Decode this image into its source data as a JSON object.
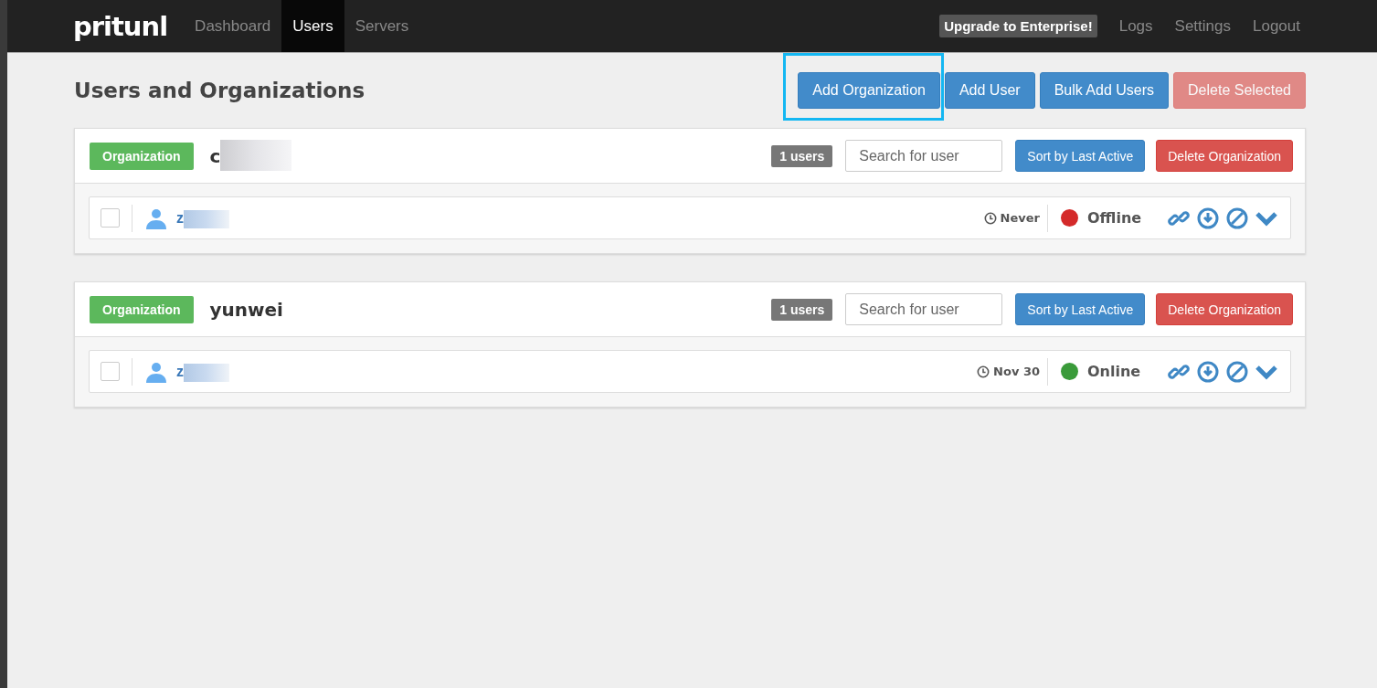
{
  "navbar": {
    "brand": "pritunl",
    "tabs": [
      {
        "label": "Dashboard",
        "selected": false
      },
      {
        "label": "Users",
        "selected": true
      },
      {
        "label": "Servers",
        "selected": false
      }
    ],
    "upgrade": "Upgrade to Enterprise!",
    "links": [
      "Logs",
      "Settings",
      "Logout"
    ]
  },
  "page": {
    "title": "Users and Organizations",
    "buttons": [
      {
        "label": "Add Organization",
        "kind": "primary",
        "highlighted": true
      },
      {
        "label": "Add User",
        "kind": "primary",
        "highlighted": false
      },
      {
        "label": "Bulk Add Users",
        "kind": "primary",
        "highlighted": false
      },
      {
        "label": "Delete Selected",
        "kind": "danger-disabled",
        "highlighted": false
      }
    ]
  },
  "organizations": [
    {
      "badge": "Organization",
      "name": "c",
      "name_blurred": true,
      "user_count": "1 users",
      "search": {
        "placeholder": "Search for user"
      },
      "sort_button": "Sort by Last Active",
      "delete_button": "Delete Organization",
      "users": [
        {
          "name": "z",
          "name_blurred": true,
          "checked": false,
          "last_active": "Never",
          "online": false,
          "status": "Offline"
        }
      ]
    },
    {
      "badge": "Organization",
      "name": "yunwei",
      "name_blurred": false,
      "user_count": "1 users",
      "search": {
        "placeholder": "Search for user"
      },
      "sort_button": "Sort by Last Active",
      "delete_button": "Delete Organization",
      "users": [
        {
          "name": "z",
          "name_blurred": true,
          "checked": false,
          "last_active": "Nov 30",
          "online": true,
          "status": "Online"
        }
      ]
    }
  ]
}
